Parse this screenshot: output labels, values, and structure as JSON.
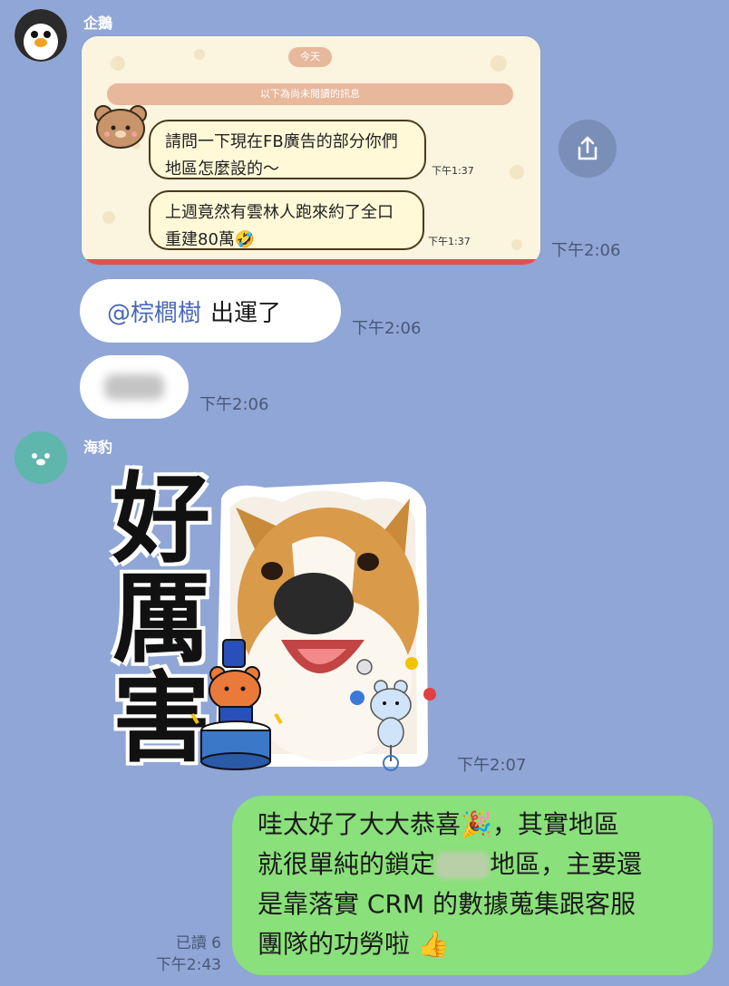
{
  "messages": {
    "penguin": {
      "sender": "企鵝",
      "screenshot": {
        "today_label": "今天",
        "unread_label": "以下為尚未閱讀的訊息",
        "bubble1": "請問一下現在FB廣告的部分你們地區怎麼設的～",
        "bubble1_time": "下午1:37",
        "bubble2": "上週竟然有雲林人跑來約了全口重建80萬🤣",
        "bubble2_time": "下午1:37",
        "time": "下午2:06"
      },
      "mention_name": "@棕櫚樹",
      "mention_text": "出運了",
      "mention_time": "下午2:06",
      "blurred_time": "下午2:06"
    },
    "seal": {
      "sender": "海豹",
      "sticker_chars": [
        "好",
        "厲",
        "害"
      ],
      "time": "下午2:07"
    },
    "me": {
      "line1": "哇太好了大大恭喜🎉，其實地區",
      "line2a": "就很單純的鎖定",
      "line2b": "地區，主要還",
      "line3": "是靠落實 CRM 的數據蒐集跟客服",
      "line4": "團隊的功勞啦 👍",
      "read": "已讀 6",
      "time": "下午2:43"
    }
  },
  "colors": {
    "background": "#8fa6d6",
    "outgoing_bubble": "#8ae07a",
    "mention": "#4a68b8"
  },
  "icons": [
    "penguin-avatar",
    "seal-avatar",
    "share-icon",
    "bear-avatar"
  ]
}
